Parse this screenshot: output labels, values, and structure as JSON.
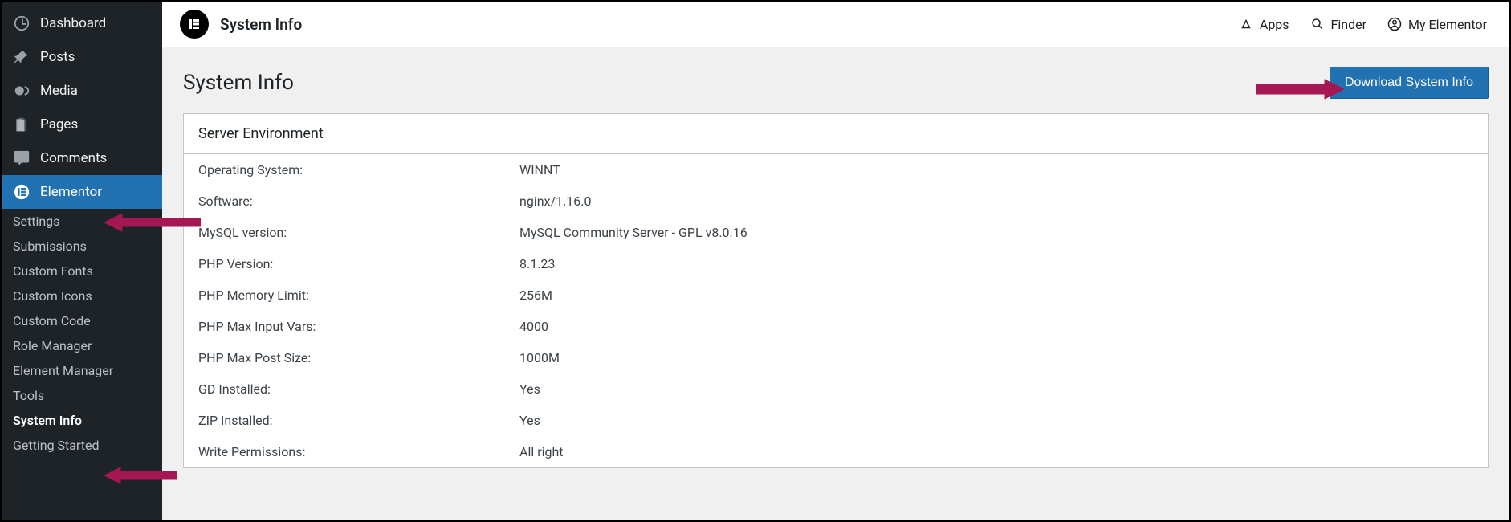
{
  "sidebar": {
    "main_items": [
      {
        "label": "Dashboard",
        "icon": "dashboard"
      },
      {
        "label": "Posts",
        "icon": "pin"
      },
      {
        "label": "Media",
        "icon": "media"
      },
      {
        "label": "Pages",
        "icon": "pages"
      },
      {
        "label": "Comments",
        "icon": "comment"
      },
      {
        "label": "Elementor",
        "icon": "elementor",
        "active": true
      }
    ],
    "sub_items": [
      {
        "label": "Settings"
      },
      {
        "label": "Submissions"
      },
      {
        "label": "Custom Fonts"
      },
      {
        "label": "Custom Icons"
      },
      {
        "label": "Custom Code"
      },
      {
        "label": "Role Manager"
      },
      {
        "label": "Element Manager"
      },
      {
        "label": "Tools"
      },
      {
        "label": "System Info",
        "current": true
      },
      {
        "label": "Getting Started"
      }
    ]
  },
  "topbar": {
    "crest": "E",
    "title": "System Info",
    "links": [
      {
        "label": "Apps",
        "icon": "triangle"
      },
      {
        "label": "Finder",
        "icon": "search"
      },
      {
        "label": "My Elementor",
        "icon": "user"
      }
    ]
  },
  "content": {
    "title": "System Info",
    "download_label": "Download System Info",
    "panel_title": "Server Environment",
    "kv": [
      {
        "k": "Operating System:",
        "v": "WINNT"
      },
      {
        "k": "Software:",
        "v": "nginx/1.16.0"
      },
      {
        "k": "MySQL version:",
        "v": "MySQL Community Server - GPL v8.0.16"
      },
      {
        "k": "PHP Version:",
        "v": "8.1.23"
      },
      {
        "k": "PHP Memory Limit:",
        "v": "256M"
      },
      {
        "k": "PHP Max Input Vars:",
        "v": "4000"
      },
      {
        "k": "PHP Max Post Size:",
        "v": "1000M"
      },
      {
        "k": "GD Installed:",
        "v": "Yes"
      },
      {
        "k": "ZIP Installed:",
        "v": "Yes"
      },
      {
        "k": "Write Permissions:",
        "v": "All right"
      }
    ]
  }
}
